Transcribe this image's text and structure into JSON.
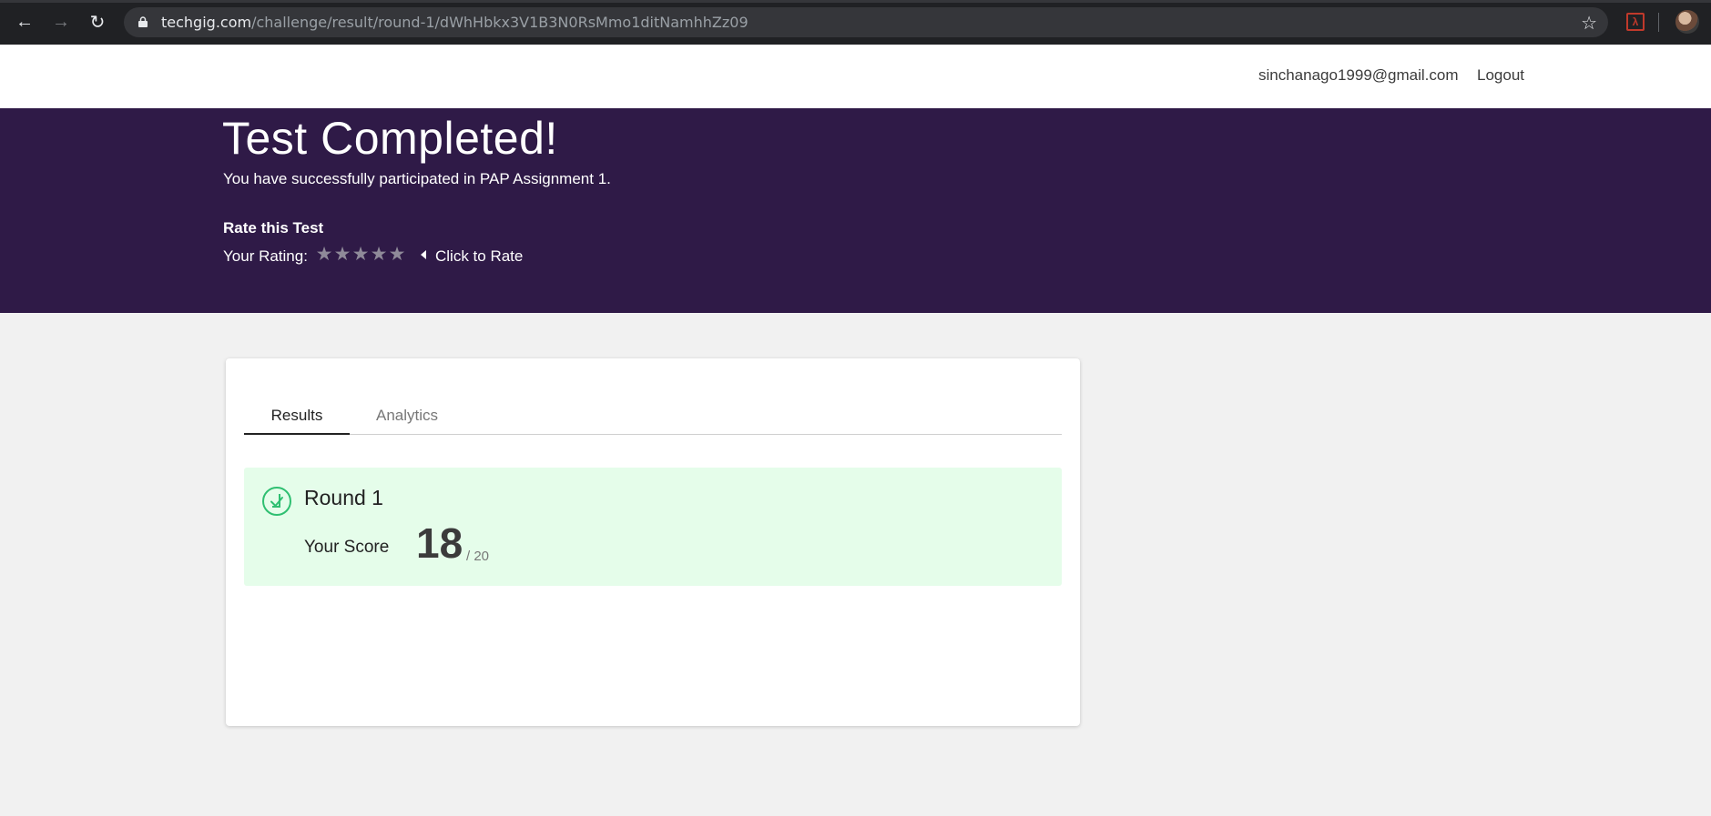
{
  "browser": {
    "url_host": "techgig.com",
    "url_path": "/challenge/result/round-1/dWhHbkx3V1B3N0RsMmo1ditNamhhZz09"
  },
  "header": {
    "email": "sinchanago1999@gmail.com",
    "logout_label": "Logout"
  },
  "banner": {
    "title": "Test Completed!",
    "subtitle": "You have successfully participated in PAP Assignment 1.",
    "rate_heading": "Rate this Test",
    "rating_label": "Your Rating:",
    "rating_value": 0,
    "rating_max": 5,
    "click_to_rate": "Click to Rate"
  },
  "tabs": [
    {
      "label": "Results",
      "active": true
    },
    {
      "label": "Analytics",
      "active": false
    }
  ],
  "result": {
    "round_title": "Round 1",
    "score_label": "Your Score",
    "score": "18",
    "score_total": "/ 20"
  },
  "colors": {
    "banner_bg": "#2f1a47",
    "result_bg": "#e5fdea",
    "check_green": "#2fbf71",
    "page_bg": "#f1f1f1"
  },
  "icons": [
    "back-arrow-icon",
    "forward-arrow-icon",
    "reload-icon",
    "lock-icon",
    "bookmark-star-icon",
    "pdf-extension-icon",
    "profile-avatar",
    "rating-star-icon",
    "caret-left-icon",
    "check-circle-icon"
  ]
}
